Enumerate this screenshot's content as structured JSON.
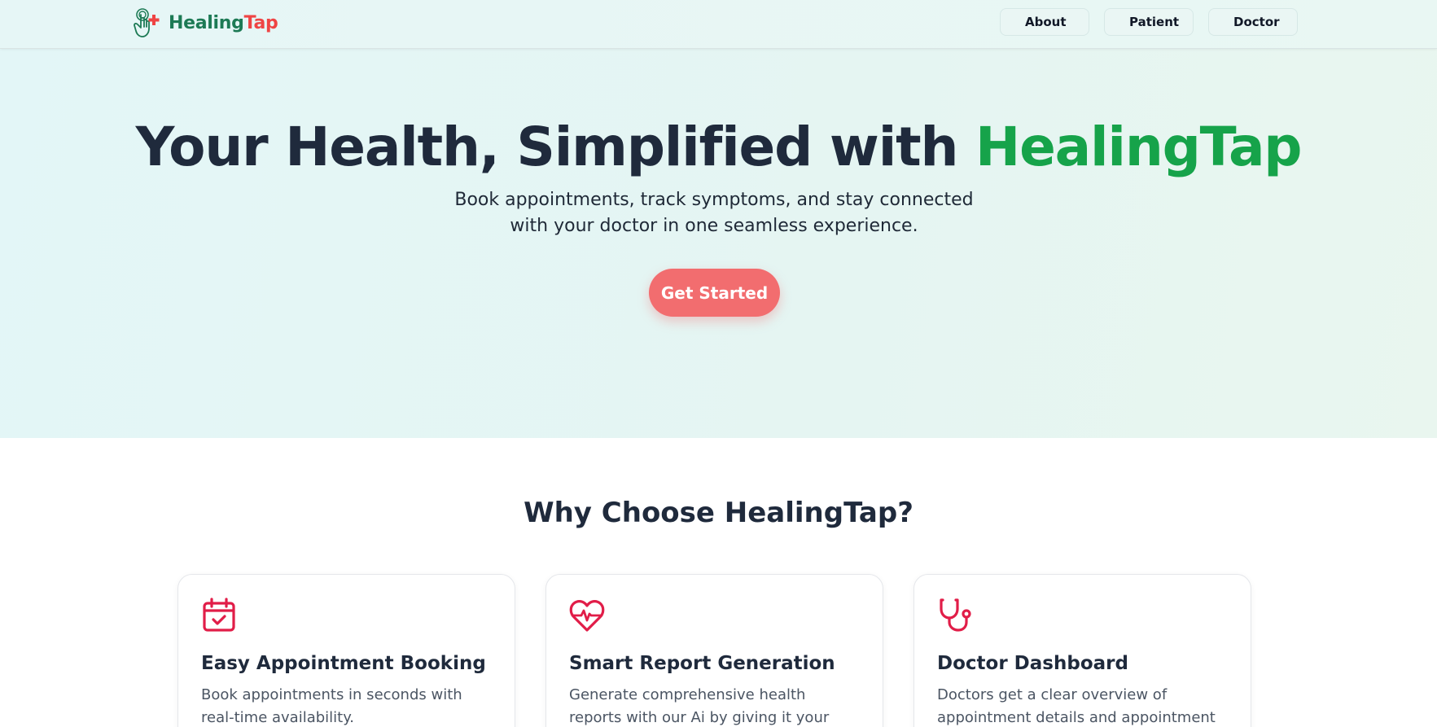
{
  "brand": {
    "name_part1": "Healing",
    "name_part2": "Tap",
    "icon": "hand-tap-plus-icon"
  },
  "nav": {
    "about": "About",
    "patient": "Patient",
    "doctor": "Doctor"
  },
  "hero": {
    "title_main": "Your Health, Simplified with ",
    "title_accent": "HealingTap",
    "subtitle": "Book appointments, track symptoms, and stay connected with your doctor in one seamless experience.",
    "cta": "Get Started"
  },
  "features": {
    "heading": "Why Choose HealingTap?",
    "items": [
      {
        "icon": "calendar-check-icon",
        "title": "Easy Appointment Booking",
        "text": "Book appointments in seconds with real-time availability."
      },
      {
        "icon": "heart-pulse-icon",
        "title": "Smart Report Generation",
        "text": "Generate comprehensive health reports with our Ai by giving it your symptoms."
      },
      {
        "icon": "stethoscope-icon",
        "title": "Doctor Dashboard",
        "text": "Doctors get a clear overview of appointment details and appointment"
      }
    ]
  },
  "colors": {
    "brand_green": "#1d7a55",
    "brand_red": "#ef4444",
    "accent_green": "#16a34a",
    "cta_bg": "#f26d6f",
    "icon_red": "#e11d48",
    "heading": "#1f2a3c"
  }
}
